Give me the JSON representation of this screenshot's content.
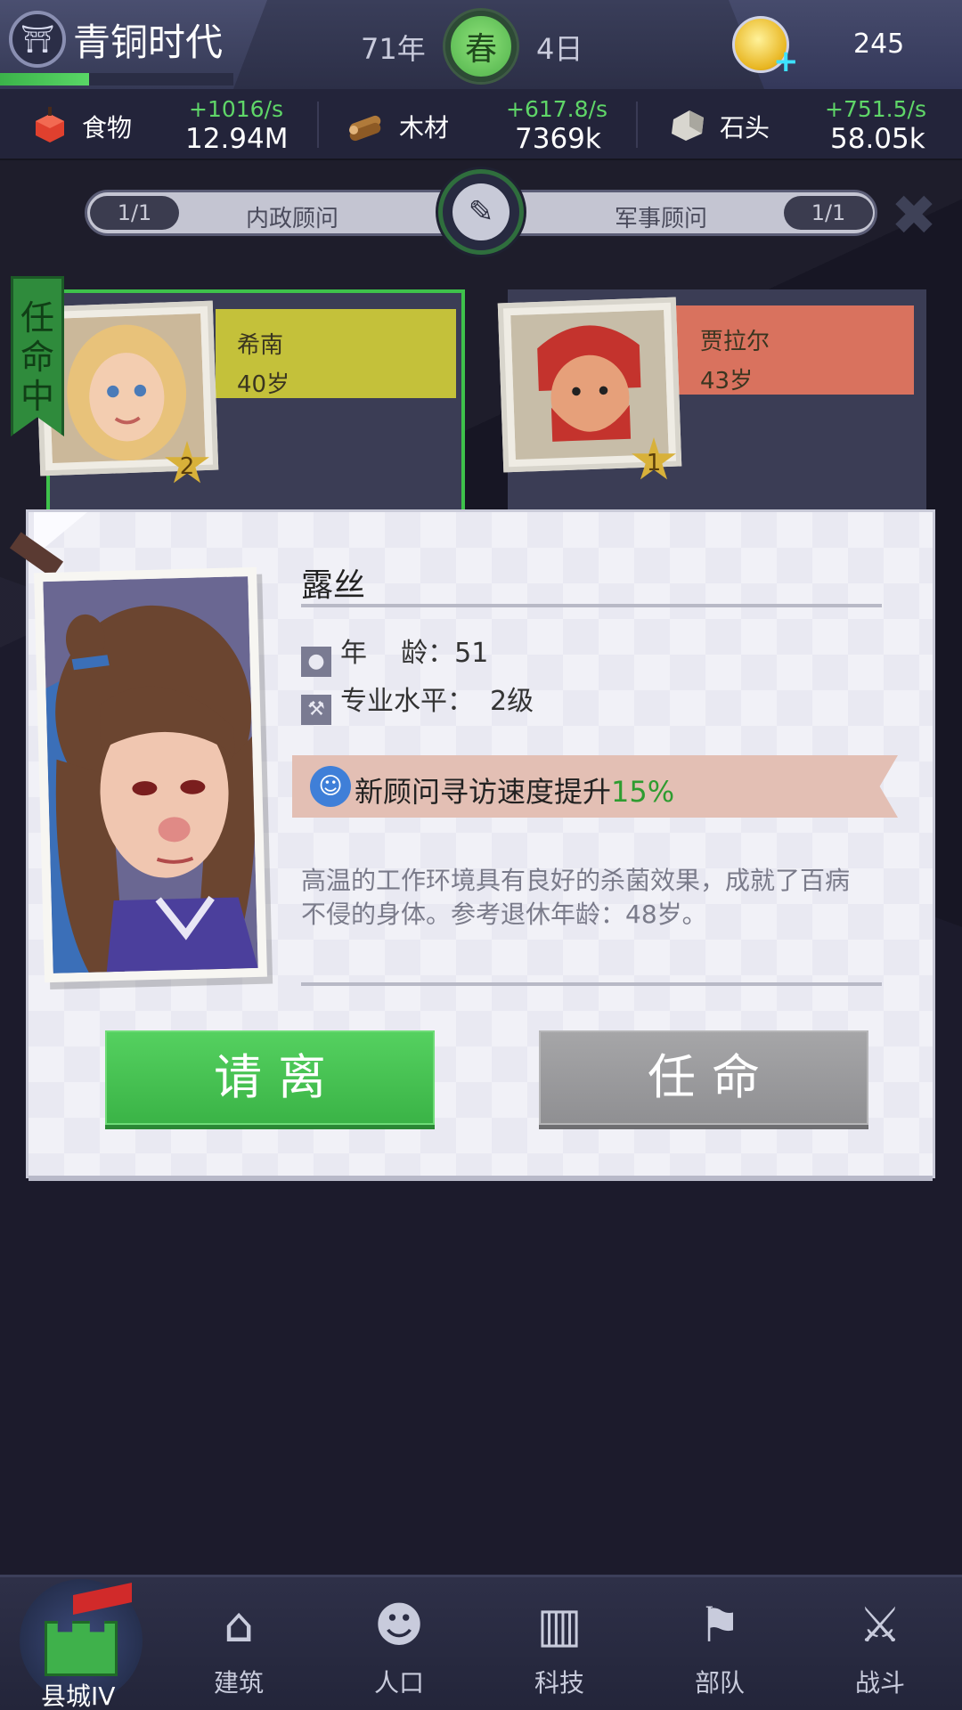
{
  "top_bar": {
    "era_title": "青铜时代",
    "era_progress_fraction": 0.38,
    "year": "71年",
    "season": "春",
    "day": "4日",
    "gold": "245"
  },
  "resources": [
    {
      "name": "食物",
      "rate": "+1016/s",
      "amount": "12.94M",
      "icon": "food-icon",
      "color": "#e0402e"
    },
    {
      "name": "木材",
      "rate": "+617.8/s",
      "amount": "7369k",
      "icon": "wood-icon",
      "color": "#b07a3a"
    },
    {
      "name": "石头",
      "rate": "+751.5/s",
      "amount": "58.05k",
      "icon": "stone-icon",
      "color": "#d8d6cf"
    }
  ],
  "advisor_tabs": {
    "left_count": "1/1",
    "left_label": "内政顾问",
    "right_label": "军事顾问",
    "right_count": "1/1"
  },
  "cards": [
    {
      "name": "希南",
      "age": "40岁",
      "level": "2",
      "banner_color": "#c4c13a",
      "status": "任命中"
    },
    {
      "name": "贾拉尔",
      "age": "43岁",
      "level": "1",
      "banner_color": "#d9725e"
    }
  ],
  "dialog": {
    "name": "露丝",
    "age_label": "年    龄：",
    "age_value": "51",
    "skill_label": "专业水平：",
    "skill_value": "2级",
    "effect_text": "新顾问寻访速度提升",
    "effect_value": "15%",
    "description": "高温的工作环境具有良好的杀菌效果，成就了百病不侵的身体。参考退休年龄：48岁。",
    "dismiss_label": "请离",
    "appoint_label": "任命"
  },
  "nav": [
    {
      "label": "县城IV",
      "icon": "castle-icon",
      "active": true
    },
    {
      "label": "建筑",
      "icon": "house-icon"
    },
    {
      "label": "人口",
      "icon": "person-icon"
    },
    {
      "label": "科技",
      "icon": "book-icon"
    },
    {
      "label": "部队",
      "icon": "banner-icon"
    },
    {
      "label": "战斗",
      "icon": "swords-icon"
    }
  ],
  "colors": {
    "accent_green": "#3ab346",
    "rate_green": "#5fd668",
    "background": "#1c1b2c"
  }
}
